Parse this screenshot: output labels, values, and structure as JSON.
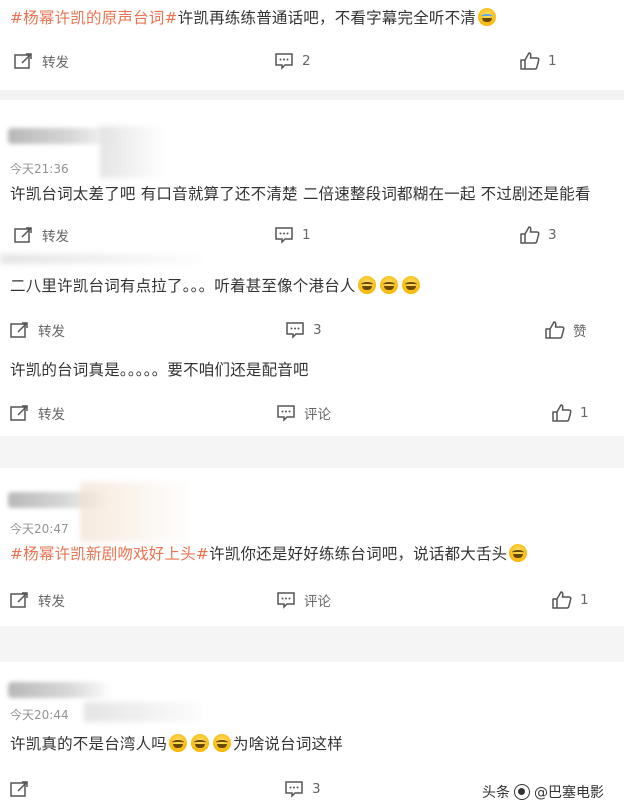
{
  "colors": {
    "tag": "#eb7350",
    "text": "#333333",
    "muted": "#939393",
    "action": "#666666",
    "separator": "#f2f2f2"
  },
  "comments": [
    {
      "tag": "#杨幂许凯的原声台词#",
      "text": "许凯再练练普通话吧，不看字幕完全听不清",
      "emoji": [
        "cry-icon"
      ],
      "actions": {
        "repost": "转发",
        "comment": "2",
        "like": "1"
      }
    },
    {
      "time": "今天21:36",
      "text": "许凯台词太差了吧 有口音就算了还不清楚 二倍速整段词都糊在一起 不过剧还是能看",
      "actions": {
        "repost": "转发",
        "comment": "1",
        "like": "3"
      }
    },
    {
      "text": "二八里许凯台词有点拉了。。。听着甚至像个港台人",
      "emoji": [
        "laugh-cry-icon",
        "laugh-cry-icon",
        "laugh-cry-icon"
      ],
      "actions": {
        "repost": "转发",
        "comment": "3",
        "like": "赞"
      }
    },
    {
      "text": "许凯的台词真是。。。。。要不咱们还是配音吧",
      "actions": {
        "repost": "转发",
        "comment": "评论",
        "like": "1"
      }
    },
    {
      "time": "今天20:47",
      "tag": "#杨幂许凯新剧吻戏好上头#",
      "text": "许凯你还是好好练练台词吧，说话都大舌头",
      "emoji": [
        "grin-sweat-icon"
      ],
      "actions": {
        "repost": "转发",
        "comment": "评论",
        "like": "1"
      }
    },
    {
      "time": "今天20:44",
      "text_a": "许凯真的不是台湾人吗",
      "text_b": "为啥说台词这样",
      "emoji": [
        "laugh-cry-icon",
        "laugh-cry-icon",
        "laugh-cry-icon"
      ],
      "actions": {
        "comment": "3"
      }
    }
  ],
  "watermark": {
    "prefix": "头条",
    "handle": "@巴塞电影"
  }
}
